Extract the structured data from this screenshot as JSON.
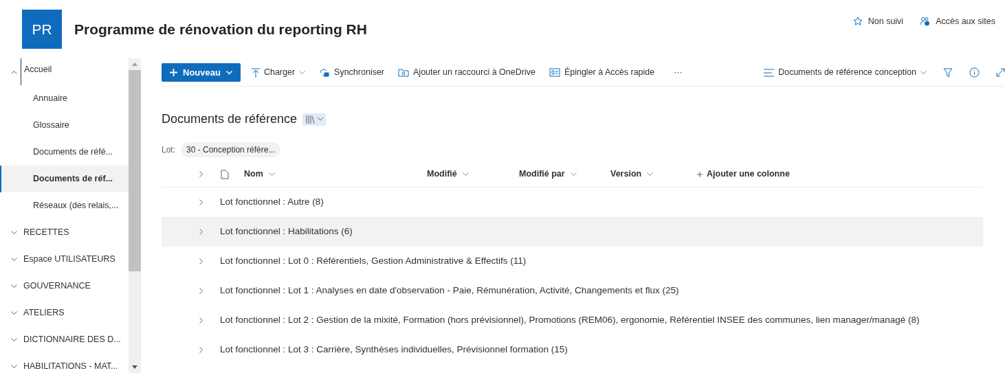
{
  "site": {
    "logo": "PR",
    "title": "Programme de rénovation du reporting RH",
    "actions": [
      {
        "kind": "star",
        "label": "Non suivi"
      },
      {
        "kind": "people",
        "label": "Accès aux sites"
      }
    ]
  },
  "nav": [
    {
      "label": "Accueil",
      "expanded": true,
      "selected": false,
      "children": [
        {
          "label": "Annuaire",
          "selected": false
        },
        {
          "label": "Glossaire",
          "selected": false
        },
        {
          "label": "Documents de réfé...",
          "selected": false
        },
        {
          "label": "Documents de réf...",
          "selected": true
        },
        {
          "label": "Réseaux (des relais,...",
          "selected": false
        }
      ]
    },
    {
      "label": "RECETTES",
      "expanded": false,
      "selected": false
    },
    {
      "label": "Espace UTILISATEURS",
      "expanded": false,
      "selected": false
    },
    {
      "label": "GOUVERNANCE",
      "expanded": false,
      "selected": false
    },
    {
      "label": "ATELIERS",
      "expanded": false,
      "selected": false
    },
    {
      "label": "DICTIONNAIRE DES D...",
      "expanded": false,
      "selected": false
    },
    {
      "label": "HABILITATIONS - MAT...",
      "expanded": false,
      "selected": false
    }
  ],
  "toolbar": {
    "new_button": "Nouveau",
    "items": [
      {
        "kind": "upload",
        "label": "Charger",
        "dropdown": true
      },
      {
        "kind": "sync",
        "label": "Synchroniser",
        "dropdown": false
      },
      {
        "kind": "shortcut",
        "label": "Ajouter un raccourci à OneDrive",
        "dropdown": false
      },
      {
        "kind": "pin",
        "label": "Épingler à Accès rapide",
        "dropdown": false
      },
      {
        "kind": "more",
        "label": "···"
      }
    ],
    "view": "Documents de référence conception"
  },
  "library": {
    "title": "Documents de référence",
    "filter_label": "Lot:",
    "filter_value": "30 - Conception référe..."
  },
  "table": {
    "columns": [
      "Nom",
      "Modifié",
      "Modifié par",
      "Version"
    ],
    "add_column": "Ajouter une colonne",
    "groups": [
      {
        "label": "Lot fonctionnel : Autre (8)",
        "selected": false
      },
      {
        "label": "Lot fonctionnel : Habilitations (6)",
        "selected": true
      },
      {
        "label": "Lot fonctionnel : Lot 0 : Référentiels, Gestion Administrative & Effectifs (11)",
        "selected": false
      },
      {
        "label": "Lot fonctionnel : Lot 1 : Analyses en date d'observation - Paie, Rémunération, Activité, Changements et flux (25)",
        "selected": false
      },
      {
        "label": "Lot fonctionnel : Lot 2 : Gestion de la mixité, Formation (hors prévisionnel), Promotions (REM06), ergonomie, Référentiel INSEE des communes, lien manager/managé (8)",
        "selected": false
      },
      {
        "label": "Lot fonctionnel : Lot 3 : Carrière, Synthèses individuelles, Prévisionnel formation (15)",
        "selected": false
      }
    ]
  }
}
